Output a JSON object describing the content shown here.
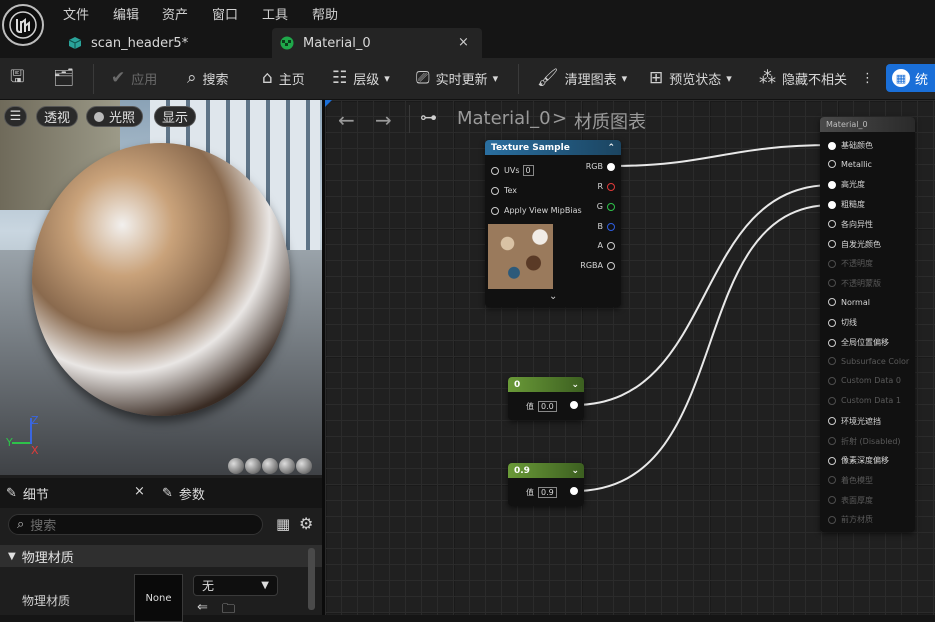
{
  "menu": {
    "file": "文件",
    "edit": "编辑",
    "assets": "资产",
    "window": "窗口",
    "tools": "工具",
    "help": "帮助"
  },
  "tabs": {
    "tab1": "scan_header5*",
    "tab2": "Material_0",
    "close": "×"
  },
  "toolbar": {
    "apply": "应用",
    "search": "搜索",
    "home": "主页",
    "hierarchy": "层级",
    "live_update": "实时更新",
    "clean_graph": "清理图表",
    "preview_state": "预览状态",
    "hide_unrelated": "隐藏不相关",
    "more": "⋮",
    "stats": "统"
  },
  "viewport": {
    "menu": "☰",
    "perspective": "透视",
    "lit": "光照",
    "show": "显示",
    "axis_z": "Z",
    "axis_y": "Y",
    "axis_x": "X"
  },
  "details": {
    "tab_details": "细节",
    "tab_params": "参数",
    "close": "×",
    "search_placeholder": "搜索",
    "category": "物理材质",
    "prop_label": "物理材质",
    "thumb_label": "None",
    "combo_value": "无"
  },
  "breadcrumb": {
    "asset": "Material_0",
    "sep": ">",
    "graph": "材质图表"
  },
  "texture_node": {
    "title": "Texture Sample",
    "uvs": "UVs",
    "uvs_val": "0",
    "tex": "Tex",
    "mip": "Apply View MipBias",
    "rgb": "RGB",
    "r": "R",
    "g": "G",
    "b": "B",
    "a": "A",
    "rgba": "RGBA"
  },
  "const0": {
    "title": "0",
    "label": "值",
    "value": "0.0"
  },
  "const09": {
    "title": "0.9",
    "label": "值",
    "value": "0.9"
  },
  "material_node": {
    "title": "Material_0",
    "pins": [
      {
        "label": "基础颜色",
        "enabled": true
      },
      {
        "label": "Metallic",
        "enabled": true
      },
      {
        "label": "高光度",
        "enabled": true
      },
      {
        "label": "粗糙度",
        "enabled": true
      },
      {
        "label": "各向异性",
        "enabled": true
      },
      {
        "label": "自发光颜色",
        "enabled": true
      },
      {
        "label": "不透明度",
        "enabled": false
      },
      {
        "label": "不透明蒙版",
        "enabled": false
      },
      {
        "label": "Normal",
        "enabled": true
      },
      {
        "label": "切线",
        "enabled": true
      },
      {
        "label": "全局位置偏移",
        "enabled": true
      },
      {
        "label": "Subsurface Color",
        "enabled": false
      },
      {
        "label": "Custom Data 0",
        "enabled": false
      },
      {
        "label": "Custom Data 1",
        "enabled": false
      },
      {
        "label": "环境光遮挡",
        "enabled": true
      },
      {
        "label": "折射 (Disabled)",
        "enabled": false
      },
      {
        "label": "像素深度偏移",
        "enabled": true
      },
      {
        "label": "着色模型",
        "enabled": false
      },
      {
        "label": "表面厚度",
        "enabled": false
      },
      {
        "label": "前方材质",
        "enabled": false
      }
    ]
  },
  "colors": {
    "accent": "#1a6fd8",
    "const_node": "#5f8a30",
    "texture_header": "#1f5a86",
    "wire": "#e8e8e8"
  }
}
